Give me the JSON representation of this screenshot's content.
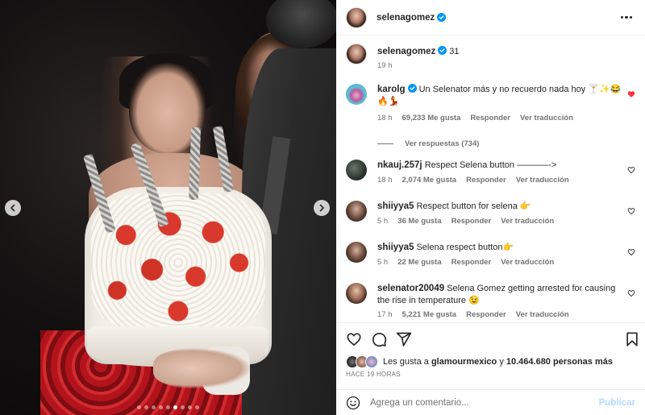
{
  "post": {
    "username": "selenagomez",
    "caption": "31",
    "caption_time": "19 h"
  },
  "comments": [
    {
      "username": "karolg",
      "verified": true,
      "text": "Un Selenator más y no recuerdo nada hoy 🍸✨😂 🔥💃",
      "time": "18 h",
      "likes": "69,233 Me gusta",
      "reply": "Responder",
      "translate": "Ver traducción",
      "liked": true,
      "view_replies": "Ver respuestas (734)"
    },
    {
      "username": "nkauj.257j",
      "text": "Respect Selena button ———–->",
      "time": "18 h",
      "likes": "2,074 Me gusta",
      "reply": "Responder",
      "translate": "Ver traducción"
    },
    {
      "username": "shiiyya5",
      "text": "Respect button for selena 👉",
      "time": "5 h",
      "likes": "36 Me gusta",
      "reply": "Responder",
      "translate": "Ver traducción"
    },
    {
      "username": "shiiyya5",
      "text": "Selena respect button👉",
      "time": "5 h",
      "likes": "22 Me gusta",
      "reply": "Responder",
      "translate": "Ver traducción"
    },
    {
      "username": "selenator20049",
      "text": "Selena Gomez getting arrested for causing the rise in temperature 😉",
      "time": "17 h",
      "likes": "5,221 Me gusta",
      "reply": "Responder",
      "translate": "Ver traducción"
    }
  ],
  "likes_summary": {
    "prefix": "Les gusta a",
    "first_user": "glamourmexico",
    "joiner": "y",
    "others": "10.464.680 personas más"
  },
  "time_ago": "HACE 19 HORAS",
  "composer": {
    "placeholder": "Agrega un comentario...",
    "publish_label": "Publicar"
  },
  "colors": {
    "verified_blue": "#0095f6",
    "liked_red": "#ff3040",
    "publish_disabled": "#b3dbff"
  }
}
